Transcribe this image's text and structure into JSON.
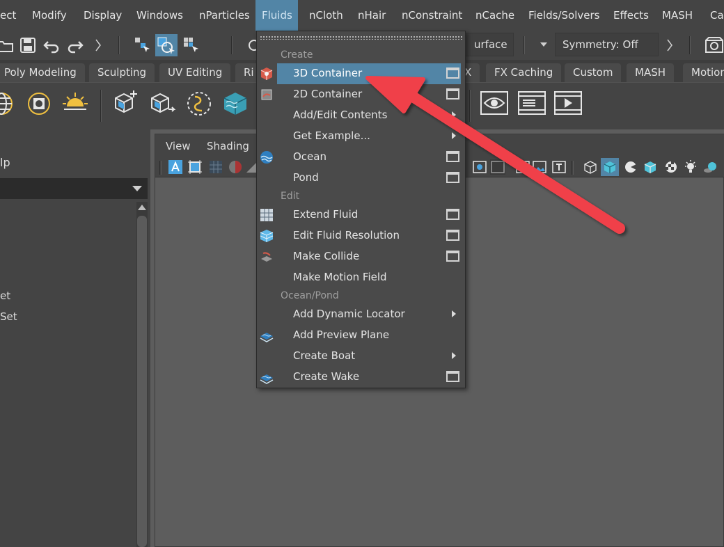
{
  "menubar": {
    "items": [
      "ect",
      "Modify",
      "Display",
      "Windows",
      "nParticles",
      "Fluids",
      "nCloth",
      "nHair",
      "nConstraint",
      "nCache",
      "Fields/Solvers",
      "Effects",
      "MASH",
      "Ca"
    ],
    "active": "Fluids"
  },
  "statusline": {
    "surface_field": "urface",
    "symmetry_field": "Symmetry: Off"
  },
  "shelf_tabs": [
    "Poly Modeling",
    "Sculpting",
    "UV Editing",
    "Ri",
    "X",
    "FX Caching",
    "Custom",
    "MASH",
    "Motion"
  ],
  "left_panel": {
    "title": "lp",
    "items": [
      "et",
      "Set"
    ]
  },
  "viewport": {
    "menus": [
      "View",
      "Shading"
    ]
  },
  "fluids_menu": {
    "sections": {
      "create": "Create",
      "edit": "Edit",
      "ocean_pond": "Ocean/Pond"
    },
    "items": [
      {
        "label": "3D Container",
        "highlighted": true,
        "option_box": true
      },
      {
        "label": "2D Container",
        "option_box": true
      },
      {
        "label": "Add/Edit Contents",
        "submenu": true
      },
      {
        "label": "Get Example...",
        "submenu": true
      },
      {
        "label": "Ocean",
        "option_box": true
      },
      {
        "label": "Pond",
        "option_box": true
      },
      {
        "label": "Extend Fluid",
        "option_box": true
      },
      {
        "label": "Edit Fluid Resolution",
        "option_box": true
      },
      {
        "label": "Make Collide",
        "option_box": true
      },
      {
        "label": "Make Motion Field"
      },
      {
        "label": "Add Dynamic Locator",
        "submenu": true
      },
      {
        "label": "Add Preview Plane"
      },
      {
        "label": "Create Boat",
        "submenu": true
      },
      {
        "label": "Create Wake",
        "option_box": true
      }
    ]
  },
  "colors": {
    "menu_highlight": "#5285a6",
    "annotation_arrow": "#f0404a"
  }
}
